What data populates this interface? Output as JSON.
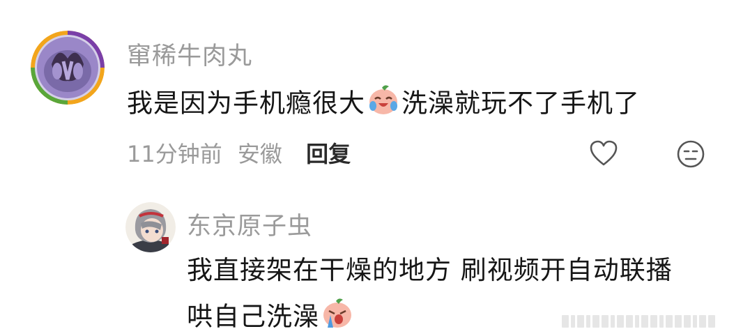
{
  "comment": {
    "username": "窜稀牛肉丸",
    "text_part1": "我是因为手机瘾很大",
    "emoji": "crying-laughing-sticker",
    "text_part2": "洗澡就玩不了手机了",
    "time": "11分钟前",
    "location": "安徽",
    "reply_label": "回复",
    "like_icon": "heart-outline-icon",
    "dislike_icon": "meh-face-icon"
  },
  "reply": {
    "username": "东京原子虫",
    "line1": "我直接架在干燥的地方 刷视频开自动联播",
    "line2": "哄自己洗澡",
    "emoji": "crying-sticker"
  },
  "colors": {
    "username": "#9a9a9a",
    "text": "#161616",
    "meta": "#9a9a9a",
    "reply_button": "#2a2a2a",
    "icon": "#555555"
  }
}
